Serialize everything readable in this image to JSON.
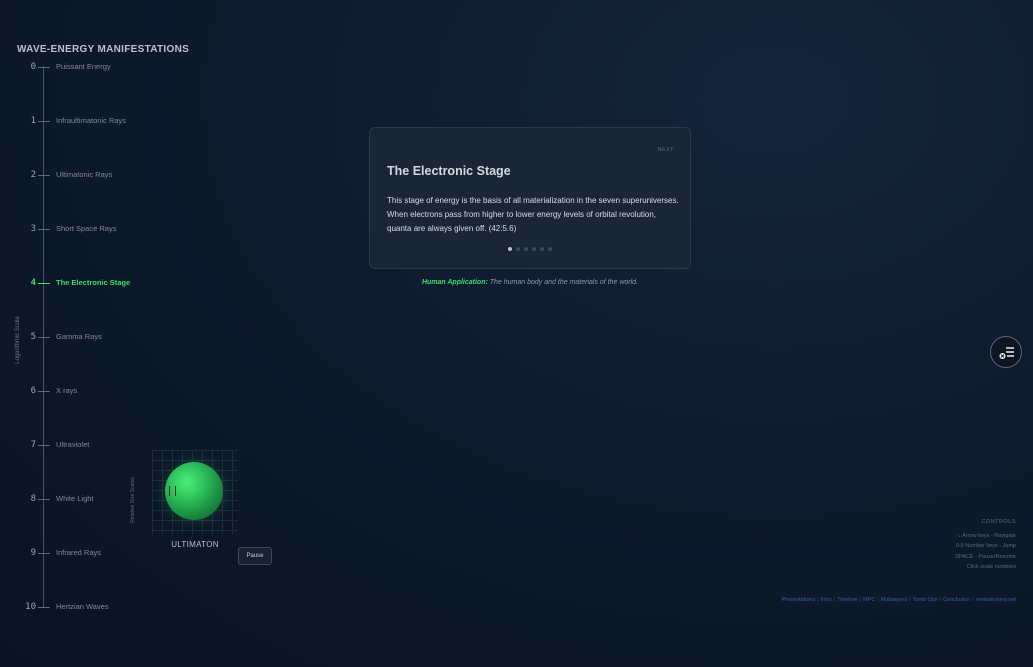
{
  "sidebar": {
    "title": "WAVE-ENERGY MANIFESTATIONS",
    "axis_title": "Logarithmic Scale",
    "active_index": 4,
    "items": [
      {
        "num": "0",
        "label": "Puissant Energy"
      },
      {
        "num": "1",
        "label": "Infraultimatonic Rays"
      },
      {
        "num": "2",
        "label": "Ultimatonic Rays"
      },
      {
        "num": "3",
        "label": "Short Space Rays"
      },
      {
        "num": "4",
        "label": "The Electronic Stage"
      },
      {
        "num": "5",
        "label": "Gamma Rays"
      },
      {
        "num": "6",
        "label": "X rays"
      },
      {
        "num": "7",
        "label": "Ultraviolet"
      },
      {
        "num": "8",
        "label": "White Light"
      },
      {
        "num": "9",
        "label": "Infrared Rays"
      },
      {
        "num": "10",
        "label": "Hertzian Waves"
      }
    ]
  },
  "visual": {
    "axis_label": "Relative Size Scales",
    "name": "ULTIMATON",
    "pause_label": "Pause",
    "sphere_color": "#2bbf5a"
  },
  "card": {
    "next_label": "NEXT",
    "title": "The Electronic Stage",
    "body": "This stage of energy is the basis of all materialization in the seven superuniverses. When electrons pass from higher to lower energy levels of orbital revolution, quanta are always given off. (42:5.6)",
    "dot_count": 6,
    "active_dot": 0
  },
  "application": {
    "label": "Human Application:",
    "text": "The human body and the materials of the world."
  },
  "fab": {
    "icon": "menu-list-icon"
  },
  "controls": {
    "title": "CONTROLS",
    "lines": [
      "↑↓ Arrow keys - Navigate",
      "0-9 Number keys - Jump",
      "SPACE - Pause/Resume",
      "Click scale numbers"
    ]
  },
  "footer": {
    "links": [
      "Presentations",
      "Intro",
      "Timeline",
      "MPC",
      "Midwayers",
      "Tomb Ops",
      "Conclusion",
      "revelationery.net"
    ],
    "separator": "|"
  },
  "colors": {
    "accent_green": "#3ddc72",
    "background": "#0e1a2c",
    "card": "#1a2535",
    "link": "#3a5fb0"
  }
}
